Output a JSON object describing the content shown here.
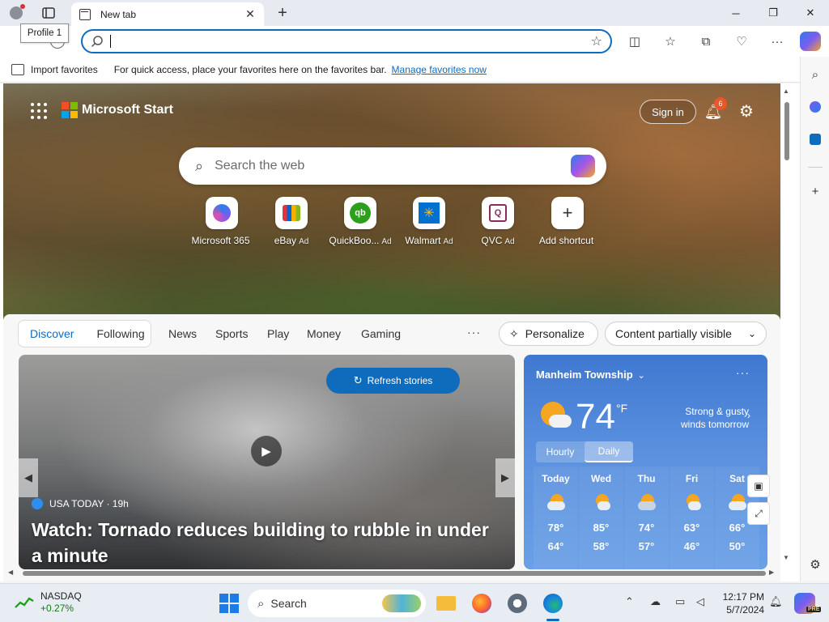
{
  "browser": {
    "tab_title": "New tab",
    "profile_tooltip": "Profile 1",
    "address_value": "",
    "favorites_bar": {
      "import_label": "Import favorites",
      "message": "For quick access, place your favorites here on the favorites bar.",
      "manage_link": "Manage favorites now"
    }
  },
  "ntp": {
    "brand": "Microsoft Start",
    "sign_in": "Sign in",
    "notification_count": "6",
    "search_placeholder": "Search the web",
    "shortcuts": [
      {
        "label": "Microsoft 365",
        "ad": ""
      },
      {
        "label": "eBay",
        "ad": "Ad"
      },
      {
        "label": "QuickBoo...",
        "ad": "Ad"
      },
      {
        "label": "Walmart",
        "ad": "Ad"
      },
      {
        "label": "QVC",
        "ad": "Ad"
      },
      {
        "label": "Add shortcut",
        "ad": ""
      }
    ],
    "feed_tabs": {
      "discover": "Discover",
      "following": "Following",
      "items": [
        "News",
        "Sports",
        "Play",
        "Money",
        "Gaming"
      ],
      "more": "···",
      "personalize": "Personalize",
      "visibility": "Content partially visible"
    },
    "story": {
      "refresh_label": "Refresh stories",
      "source": "USA TODAY · 19h",
      "headline": "Watch: Tornado reduces building to rubble in under a minute"
    },
    "weather": {
      "location": "Manheim Township",
      "temperature": "74",
      "unit": "°F",
      "note": "Strong & gusty winds tomorrow",
      "toggle": [
        "Hourly",
        "Daily"
      ],
      "active_toggle": "Daily",
      "days": [
        {
          "name": "Today",
          "high": "78°",
          "low": "64°"
        },
        {
          "name": "Wed",
          "high": "85°",
          "low": "58°"
        },
        {
          "name": "Thu",
          "high": "74°",
          "low": "57°"
        },
        {
          "name": "Fri",
          "high": "63°",
          "low": "46°"
        },
        {
          "name": "Sat",
          "high": "66°",
          "low": "50°"
        }
      ]
    }
  },
  "taskbar": {
    "stock_name": "NASDAQ",
    "stock_change": "+0.27%",
    "search_label": "Search",
    "time": "12:17 PM",
    "date": "5/7/2024",
    "copilot_badge": "PRE"
  },
  "icons": {
    "accent": "#0f6cbd",
    "weather_bg": "#3f78d1"
  }
}
